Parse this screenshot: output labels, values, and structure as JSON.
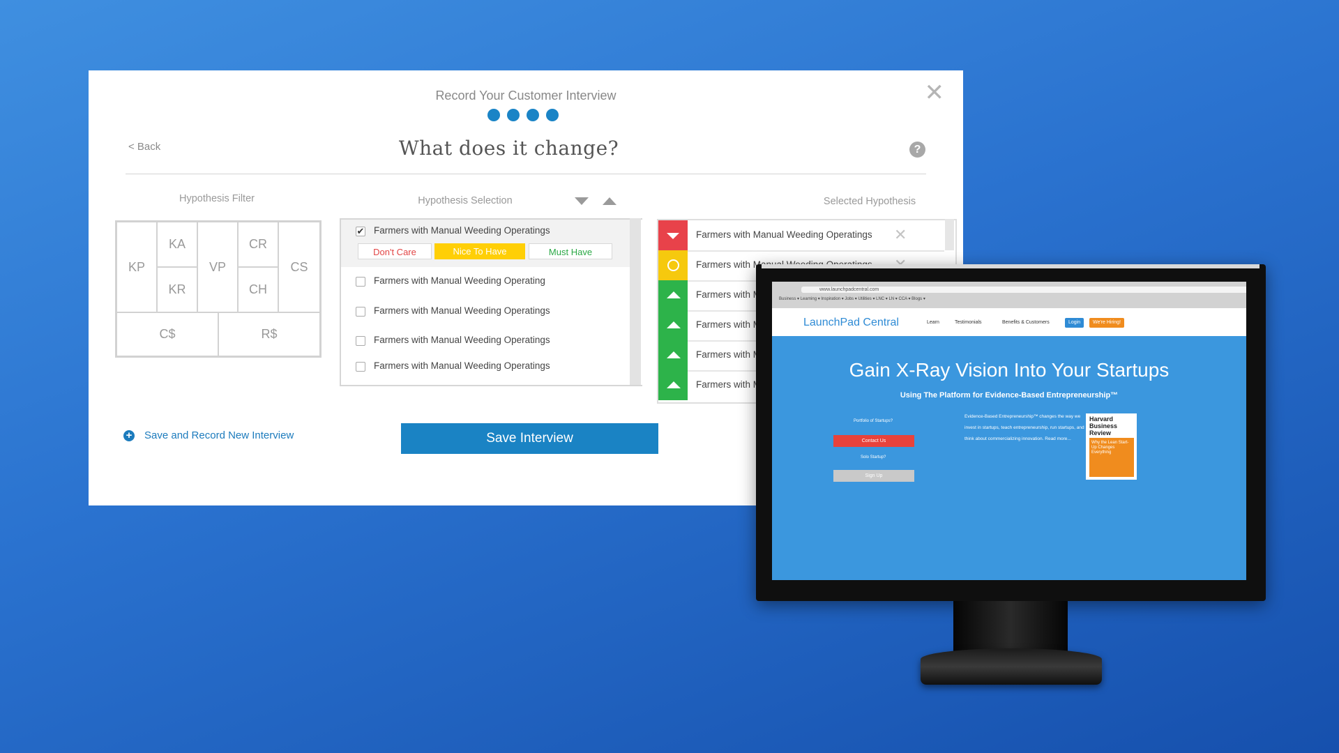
{
  "modal": {
    "subtitle": "Record Your Customer Interview",
    "steps": 4,
    "close_icon": "✕",
    "back_label": "< Back",
    "title": "What does it change?",
    "help_icon": "?"
  },
  "filter": {
    "title": "Hypothesis Filter",
    "cells": {
      "kp": "KP",
      "ka": "KA",
      "kr": "KR",
      "vp": "VP",
      "cr": "CR",
      "ch": "CH",
      "cs": "CS",
      "cost": "C$",
      "revenue": "R$"
    }
  },
  "selection": {
    "title": "Hypothesis Selection",
    "rows": [
      {
        "label": "Farmers with Manual Weeding Operatings",
        "checked": true
      },
      {
        "label": "Farmers with Manual Weeding Operating",
        "checked": false
      },
      {
        "label": "Farmers with Manual Weeding Operatings",
        "checked": false
      },
      {
        "label": "Farmers with Manual Weeding Operatings",
        "checked": false
      },
      {
        "label": "Farmers with Manual Weeding Operatings",
        "checked": false
      }
    ],
    "ratings": {
      "dont_care": "Don't Care",
      "nice_to_have": "Nice To Have",
      "must_have": "Must Have"
    },
    "checkmark": "✔"
  },
  "selected": {
    "title": "Selected Hypothesis",
    "remove_icon": "✕",
    "rows": [
      {
        "label": "Farmers with Manual Weeding Operatings",
        "status": "dont-care",
        "color": "#e8424a"
      },
      {
        "label": "Farmers with Manual Weeding Operatings",
        "status": "nice-to-have",
        "color": "#f6c90e"
      },
      {
        "label": "Farmers with M",
        "status": "must-have",
        "color": "#2db34a"
      },
      {
        "label": "Farmers with M",
        "status": "must-have",
        "color": "#2db34a"
      },
      {
        "label": "Farmers with M",
        "status": "must-have",
        "color": "#2db34a"
      },
      {
        "label": "Farmers with M",
        "status": "must-have",
        "color": "#2db34a"
      }
    ]
  },
  "actions": {
    "save_new_label": "Save and Record New Interview",
    "save_label": "Save Interview",
    "plus_icon": "+"
  },
  "monitor": {
    "url": "www.launchpadcentral.com",
    "bookmarks": "Business ▾   Learning ▾   Inspiration ▾   Jobs ▾   Utilities ▾   LNC ▾   LN ▾   CCA ▾   Blogs ▾",
    "logo": "LaunchPad Central",
    "nav": [
      "Learn",
      "Testimonials",
      "Benefits & Customers"
    ],
    "login": "Login",
    "hiring": "We're Hiring!",
    "hero_title": "Gain X-Ray Vision Into Your Startups",
    "hero_sub": "Using The Platform for Evidence-Based Entrepreneurship™",
    "portfolio_label": "Portfolio of Startups?",
    "contact": "Contact Us",
    "solo_label": "Solo Startup?",
    "signup": "Sign Up",
    "description": "Evidence-Based Entrepreneurship™ changes the way we invest in startups, teach entrepreneurship, run startups, and think about commercializing innovation. Read more...",
    "hbr_title": "Harvard Business Review",
    "hbr_cover": "Why the Lean Start-Up Changes Everything"
  },
  "colors": {
    "accent": "#1a83c4",
    "dont_care": "#e8424a",
    "nice_to_have": "#f6c90e",
    "must_have": "#2db34a"
  }
}
